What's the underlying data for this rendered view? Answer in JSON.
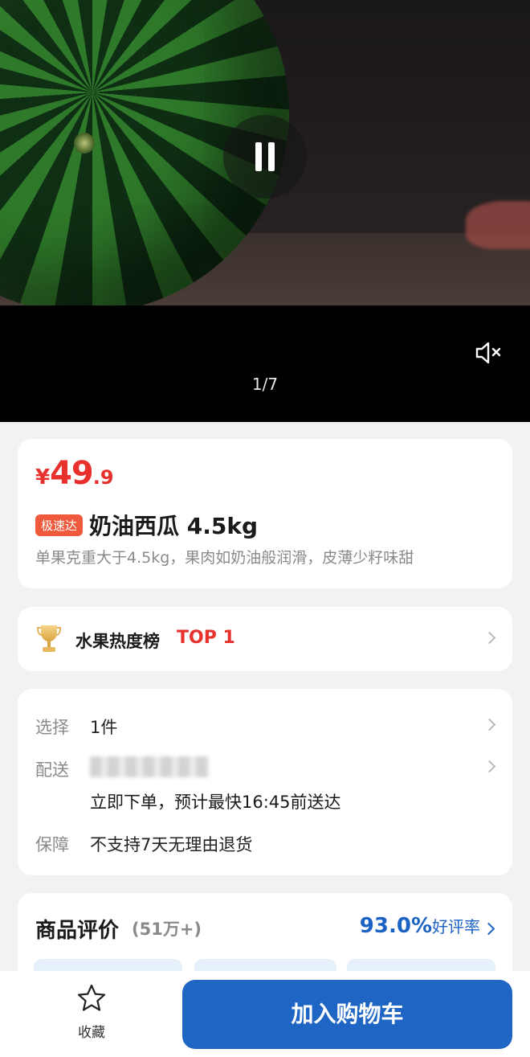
{
  "media": {
    "page_indicator": "1/7",
    "play_state": "playing",
    "muted": true
  },
  "product": {
    "price_symbol": "¥",
    "price_integer": "49",
    "price_decimal": ".9",
    "badge": "极速达",
    "title": "奶油西瓜 4.5kg",
    "subtitle": "单果克重大于4.5kg，果肉如奶油般润滑，皮薄少籽味甜"
  },
  "ranking": {
    "label": "水果热度榜",
    "position": "TOP 1"
  },
  "specs": {
    "select_key": "选择",
    "select_value": "1件",
    "delivery_key": "配送",
    "delivery_eta": "立即下单，预计最快16:45前送达",
    "guarantee_key": "保障",
    "guarantee_value": "不支持7天无理由退货"
  },
  "reviews": {
    "title": "商品评价",
    "count": "(51万+)",
    "rate": "93.0%",
    "rate_label": "好评率"
  },
  "bottom_bar": {
    "favorite_label": "收藏",
    "add_to_cart_label": "加入购物车"
  },
  "colors": {
    "price_red": "#e8302d",
    "badge_orange": "#ef5a3c",
    "brand_blue": "#1f66c4"
  }
}
